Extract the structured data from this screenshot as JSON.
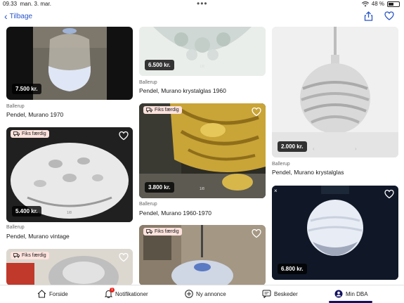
{
  "status": {
    "time": "09.33",
    "date": "man. 3. mar.",
    "battery": "48 %"
  },
  "nav": {
    "back_label": "Tilbage"
  },
  "cards": [
    {
      "price": "7.500 kr.",
      "location": "Ballerup",
      "title": "Pendel, Murano 1970"
    },
    {
      "price": "6.500 kr.",
      "location": "Ballerup",
      "title": "Pendel, Murano krystalglas 1960"
    },
    {
      "price": "2.000 kr.",
      "location": "Ballerup",
      "title": "Pendel, Murano krystalglas"
    },
    {
      "price": "5.400 kr.",
      "location": "Ballerup",
      "title": "Pendel, Murano vintage",
      "badge": "Fiks færdig"
    },
    {
      "price": "3.800 kr.",
      "location": "Ballerup",
      "title": "Pendel, Murano 1960-1970",
      "badge": "Fiks færdig"
    },
    {
      "price": "6.800 kr."
    },
    {
      "badge": "Fiks færdig"
    },
    {
      "badge": "Fiks færdig"
    }
  ],
  "tabs": {
    "forside": "Forside",
    "notifikationer": "Notifikationer",
    "notif_count": "1",
    "ny_annonce": "Ny annonce",
    "beskeder": "Beskeder",
    "min_dba": "Min DBA"
  },
  "colors": {
    "accent": "#2a55c8",
    "active_tab": "#12105f",
    "badge_bg": "#fde2dd"
  }
}
